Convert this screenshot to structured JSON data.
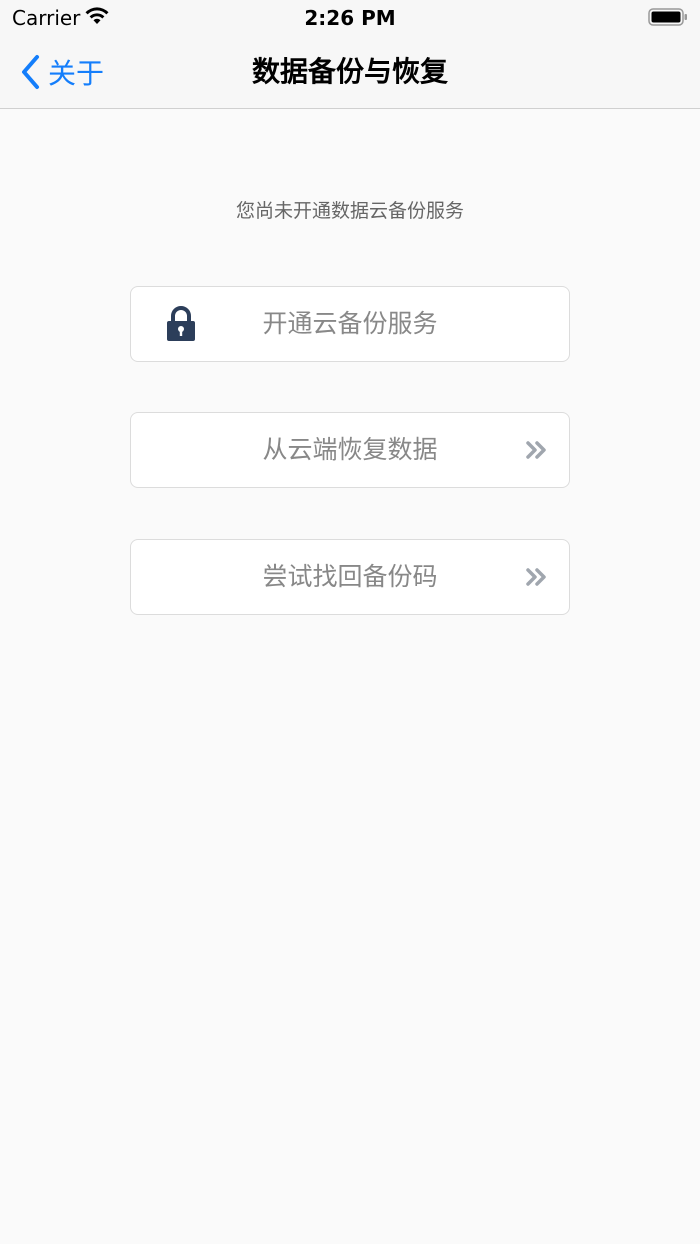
{
  "status_bar": {
    "carrier": "Carrier",
    "time": "2:26 PM",
    "icons": [
      "wifi-icon",
      "battery-icon"
    ]
  },
  "nav": {
    "back_label": "关于",
    "title": "数据备份与恢复",
    "accent_color": "#147efb"
  },
  "main": {
    "subtitle": "您尚未开通数据云备份服务",
    "options": [
      {
        "label": "开通云备份服务",
        "icon": "lock-icon",
        "icon_color": "#2c3e5a"
      },
      {
        "label": "从云端恢复数据",
        "icon": "chevrons-right-icon"
      },
      {
        "label": "尝试找回备份码",
        "icon": "chevrons-right-icon"
      }
    ]
  }
}
